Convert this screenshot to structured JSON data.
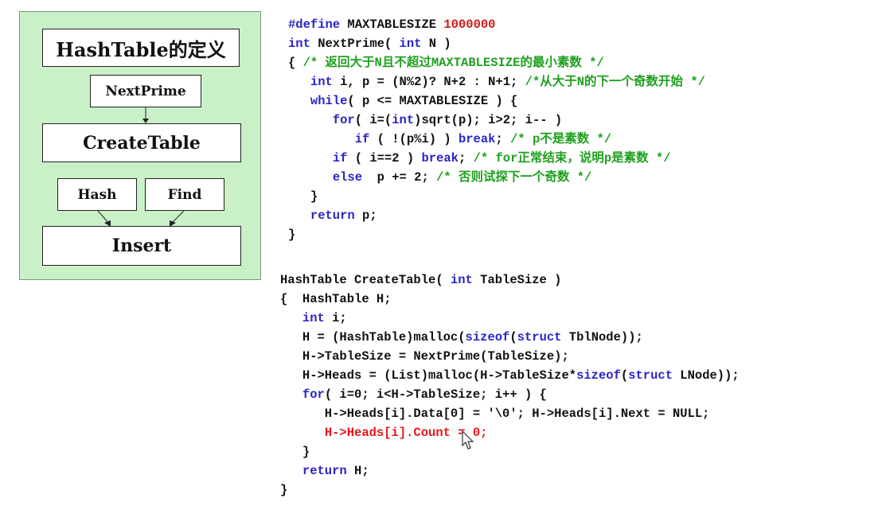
{
  "diagram": {
    "title": "HashTable的定义",
    "nodes": {
      "next_prime": "NextPrime",
      "create_table": "CreateTable",
      "hash": "Hash",
      "find": "Find",
      "insert": "Insert"
    }
  },
  "colors": {
    "panel": "#c9f0c6",
    "keyword": "#2b24c8",
    "comment": "#1ea01e",
    "number": "#d41818",
    "highlight": "#e8141a"
  },
  "code_next_prime": [
    [
      {
        "t": "#define",
        "c": "kw"
      },
      {
        "t": " MAXTABLESIZE "
      },
      {
        "t": "1000000",
        "c": "num"
      }
    ],
    [
      {
        "t": "int",
        "c": "kw"
      },
      {
        "t": " NextPrime( "
      },
      {
        "t": "int",
        "c": "kw"
      },
      {
        "t": " N )"
      }
    ],
    [
      {
        "t": "{ "
      },
      {
        "t": "/* 返回大于N且不超过MAXTABLESIZE的最小素数 */",
        "c": "cm"
      }
    ],
    [
      {
        "t": "   "
      },
      {
        "t": "int",
        "c": "kw"
      },
      {
        "t": " i, p = (N%2)? N+2 : N+1; "
      },
      {
        "t": "/*从大于N的下一个奇数开始 */",
        "c": "cm"
      }
    ],
    [
      {
        "t": "   "
      },
      {
        "t": "while",
        "c": "kw"
      },
      {
        "t": "( p <= MAXTABLESIZE ) {"
      }
    ],
    [
      {
        "t": "      "
      },
      {
        "t": "for",
        "c": "kw"
      },
      {
        "t": "( i=("
      },
      {
        "t": "int",
        "c": "kw"
      },
      {
        "t": ")sqrt(p); i>2; i-- )"
      }
    ],
    [
      {
        "t": "         "
      },
      {
        "t": "if",
        "c": "kw"
      },
      {
        "t": " ( !(p%i) ) "
      },
      {
        "t": "break",
        "c": "kw"
      },
      {
        "t": "; "
      },
      {
        "t": "/* p不是素数 */",
        "c": "cm"
      }
    ],
    [
      {
        "t": "      "
      },
      {
        "t": "if",
        "c": "kw"
      },
      {
        "t": " ( i==2 ) "
      },
      {
        "t": "break",
        "c": "kw"
      },
      {
        "t": "; "
      },
      {
        "t": "/* for正常结束，说明p是素数 */",
        "c": "cm"
      }
    ],
    [
      {
        "t": "      "
      },
      {
        "t": "else",
        "c": "kw"
      },
      {
        "t": "  p += 2; "
      },
      {
        "t": "/* 否则试探下一个奇数 */",
        "c": "cm"
      }
    ],
    [
      {
        "t": "   }"
      }
    ],
    [
      {
        "t": "   "
      },
      {
        "t": "return",
        "c": "kw"
      },
      {
        "t": " p;"
      }
    ],
    [
      {
        "t": "}"
      }
    ]
  ],
  "code_create_table": [
    [
      {
        "t": "HashTable CreateTable( "
      },
      {
        "t": "int",
        "c": "kw"
      },
      {
        "t": " TableSize )"
      }
    ],
    [
      {
        "t": "{  HashTable H;"
      }
    ],
    [
      {
        "t": "   "
      },
      {
        "t": "int",
        "c": "kw"
      },
      {
        "t": " i;"
      }
    ],
    [
      {
        "t": "   H = (HashTable)malloc("
      },
      {
        "t": "sizeof",
        "c": "kw"
      },
      {
        "t": "("
      },
      {
        "t": "struct",
        "c": "kw"
      },
      {
        "t": " TblNode));"
      }
    ],
    [
      {
        "t": "   H->TableSize = NextPrime(TableSize);"
      }
    ],
    [
      {
        "t": "   H->Heads = (List)malloc(H->TableSize*"
      },
      {
        "t": "sizeof",
        "c": "kw"
      },
      {
        "t": "("
      },
      {
        "t": "struct",
        "c": "kw"
      },
      {
        "t": " LNode));"
      }
    ],
    [
      {
        "t": "   "
      },
      {
        "t": "for",
        "c": "kw"
      },
      {
        "t": "( i=0; i<H->TableSize; i++ ) {"
      }
    ],
    [
      {
        "t": "      H->Heads[i].Data[0] = '\\0'; H->Heads[i].Next = NULL;"
      }
    ],
    [
      {
        "t": "      "
      },
      {
        "t": "H->Heads[i].Count = 0;",
        "c": "hl"
      }
    ],
    [
      {
        "t": "   }"
      }
    ],
    [
      {
        "t": "   "
      },
      {
        "t": "return",
        "c": "kw"
      },
      {
        "t": " H;"
      }
    ],
    [
      {
        "t": "}"
      }
    ]
  ]
}
